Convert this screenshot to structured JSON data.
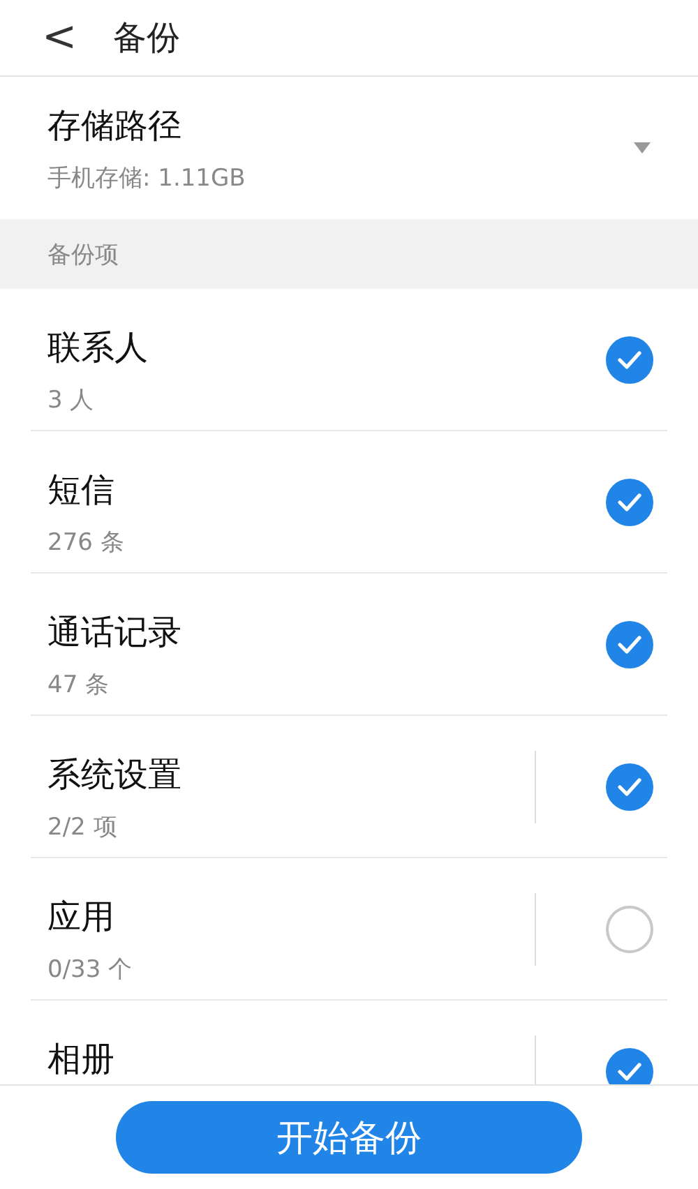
{
  "header": {
    "back": "<",
    "title": "备份"
  },
  "storage": {
    "title": "存储路径",
    "subtitle": "手机存储: 1.11GB"
  },
  "section": {
    "title": "备份项"
  },
  "items": [
    {
      "title": "联系人",
      "subtitle": "3 人",
      "checked": true,
      "divider": false
    },
    {
      "title": "短信",
      "subtitle": "276 条",
      "checked": true,
      "divider": false
    },
    {
      "title": "通话记录",
      "subtitle": "47 条",
      "checked": true,
      "divider": false
    },
    {
      "title": "系统设置",
      "subtitle": "2/2 项",
      "checked": true,
      "divider": true
    },
    {
      "title": "应用",
      "subtitle": "0/33 个",
      "checked": false,
      "divider": true
    },
    {
      "title": "相册",
      "checked": true,
      "divider": true
    }
  ],
  "action": {
    "label": "开始备份"
  }
}
